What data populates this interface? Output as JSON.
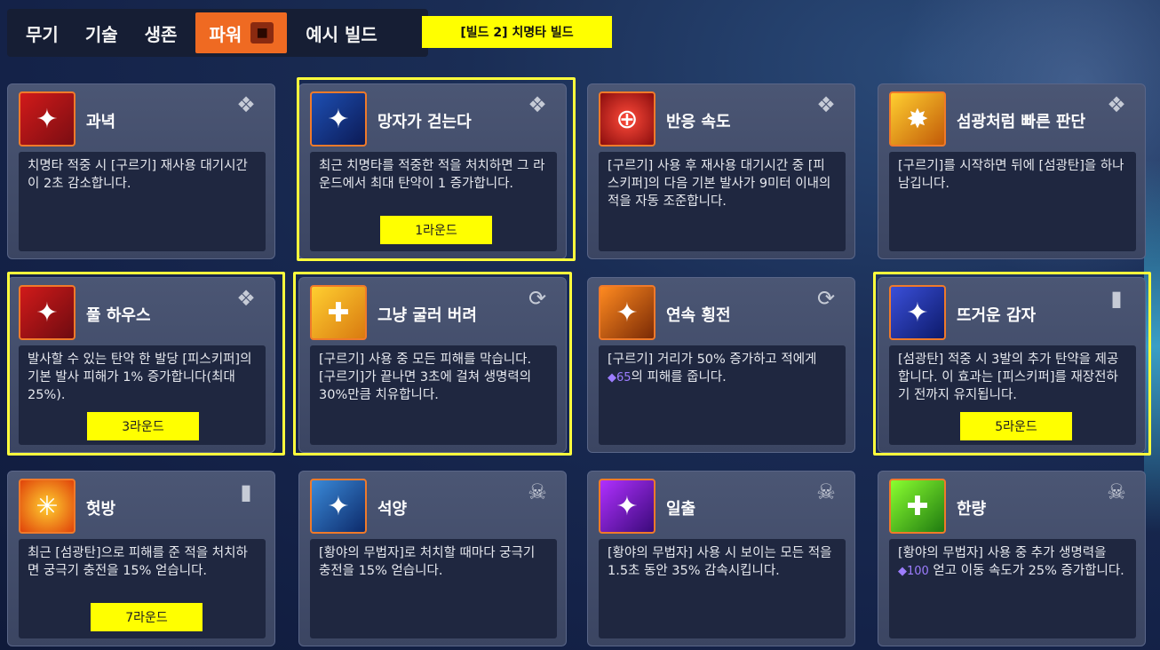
{
  "tabs": [
    {
      "label": "무기"
    },
    {
      "label": "기술"
    },
    {
      "label": "생존"
    },
    {
      "label": "파워"
    },
    {
      "label": "예시 빌드"
    }
  ],
  "build_label": "[빌드 2] 치명타 빌드",
  "cards": [
    {
      "title": "과녁",
      "type": "revolver",
      "desc": "치명타 적중 시 [구르기] 재사용 대기시간이 2초 감소합니다."
    },
    {
      "title": "망자가 걷는다",
      "type": "revolver",
      "desc": "최근 치명타를 적중한 적을 처치하면 그 라운드에서 최대 탄약이 1 증가합니다."
    },
    {
      "title": "반응 속도",
      "type": "revolver",
      "desc": "[구르기] 사용 후 재사용 대기시간 중 [피스키퍼]의 다음 기본 발사가 9미터 이내의 적을 자동 조준합니다."
    },
    {
      "title": "섬광처럼 빠른 판단",
      "type": "revolver",
      "desc": "[구르기]를 시작하면 뒤에 [섬광탄]을 하나 남깁니다."
    },
    {
      "title": "풀 하우스",
      "type": "revolver",
      "desc": "발사할 수 있는 탄약 한 발당 [피스키퍼]의 기본 발사 피해가 1% 증가합니다(최대 25%)."
    },
    {
      "title": "그냥 굴러 버려",
      "type": "roll",
      "desc": "[구르기] 사용 중 모든 피해를 막습니다. [구르기]가 끝나면 3초에 걸쳐 생명력의 30%만큼 치유합니다."
    },
    {
      "title": "연속 횡전",
      "type": "roll",
      "desc_pre": "[구르기] 거리가 50% 증가하고 적에게 ",
      "desc_gem": "65",
      "desc_post": "의 피해를 줍니다."
    },
    {
      "title": "뜨거운 감자",
      "type": "flashbang",
      "desc": "[섬광탄] 적중 시 3발의 추가 탄약을 제공합니다. 이 효과는 [피스키퍼]를 재장전하기 전까지 유지됩니다."
    },
    {
      "title": "헛방",
      "type": "flashbang",
      "desc": "최근 [섬광탄]으로 피해를 준 적을 처치하면 궁극기 충전을 15% 얻습니다."
    },
    {
      "title": "석양",
      "type": "ultimate",
      "desc": "[황야의 무법자]로 처치할 때마다 궁극기 충전을 15% 얻습니다."
    },
    {
      "title": "일출",
      "type": "ultimate",
      "desc": "[황야의 무법자] 사용 시 보이는 모든 적을 1.5초 동안 35% 감속시킵니다."
    },
    {
      "title": "한량",
      "type": "ultimate",
      "desc_pre": "[황야의 무법자] 사용 중 추가 생명력을 ",
      "desc_gem": "100",
      "desc_post": " 얻고 이동 속도가 25% 증가합니다."
    }
  ],
  "round_labels": [
    "1라운드",
    "3라운드",
    "5라운드",
    "7라운드"
  ],
  "colors": {
    "accent": "#ef6a22",
    "highlight": "#ffff00",
    "gem": "#9d7dff"
  }
}
